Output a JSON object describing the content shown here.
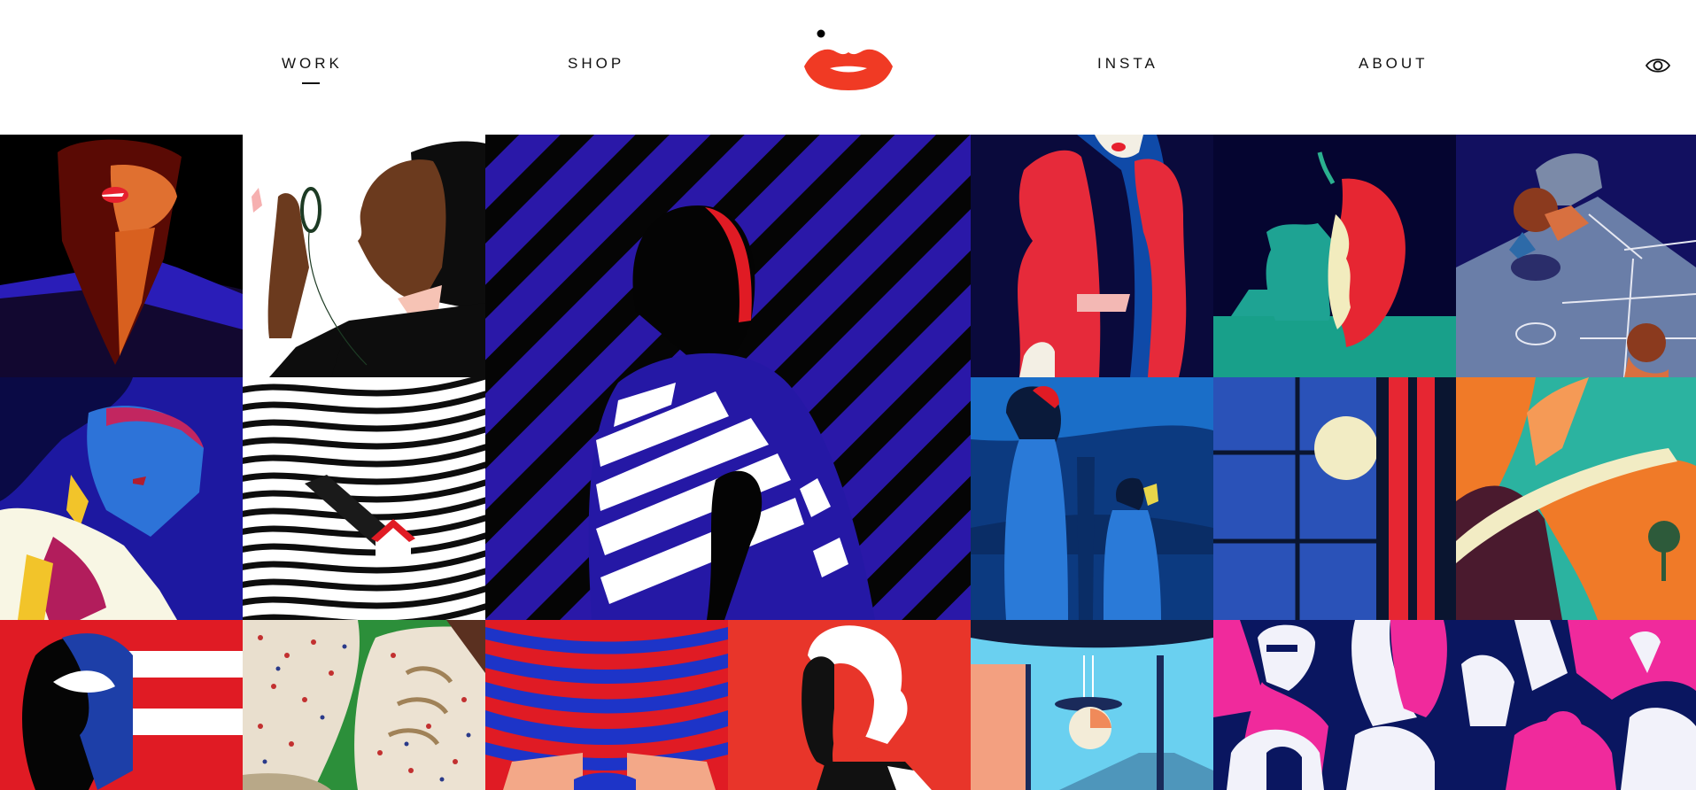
{
  "nav": {
    "items": [
      {
        "label": "WORK",
        "active": true
      },
      {
        "label": "SHOP",
        "active": false
      },
      {
        "label": "INSTA",
        "active": false
      },
      {
        "label": "ABOUT",
        "active": false
      }
    ],
    "logo_icon": "red-lips-logo",
    "accessibility_icon": "eye-icon"
  },
  "colors": {
    "brand_red": "#f03a24",
    "nav_text": "#111111",
    "navy": "#0a0a3c",
    "royal_blue": "#2418a8",
    "crimson": "#e8213a"
  },
  "gallery": {
    "tiles": [
      {
        "name": "woman-red-lips-dark"
      },
      {
        "name": "woman-with-mirror"
      },
      {
        "name": "striped-shirt-woman"
      },
      {
        "name": "red-hair-woman"
      },
      {
        "name": "apple-core-faces"
      },
      {
        "name": "hopscotch-kids"
      },
      {
        "name": "woman-blue-face"
      },
      {
        "name": "wavy-lines-house"
      },
      {
        "name": "theater-balcony"
      },
      {
        "name": "window-moon"
      },
      {
        "name": "canyon-road"
      },
      {
        "name": "red-flag-face"
      },
      {
        "name": "printed-sneakers"
      },
      {
        "name": "red-blue-stripes-figure"
      },
      {
        "name": "mozart-portrait"
      },
      {
        "name": "lamp-interior"
      },
      {
        "name": "crowd-pink"
      }
    ]
  }
}
